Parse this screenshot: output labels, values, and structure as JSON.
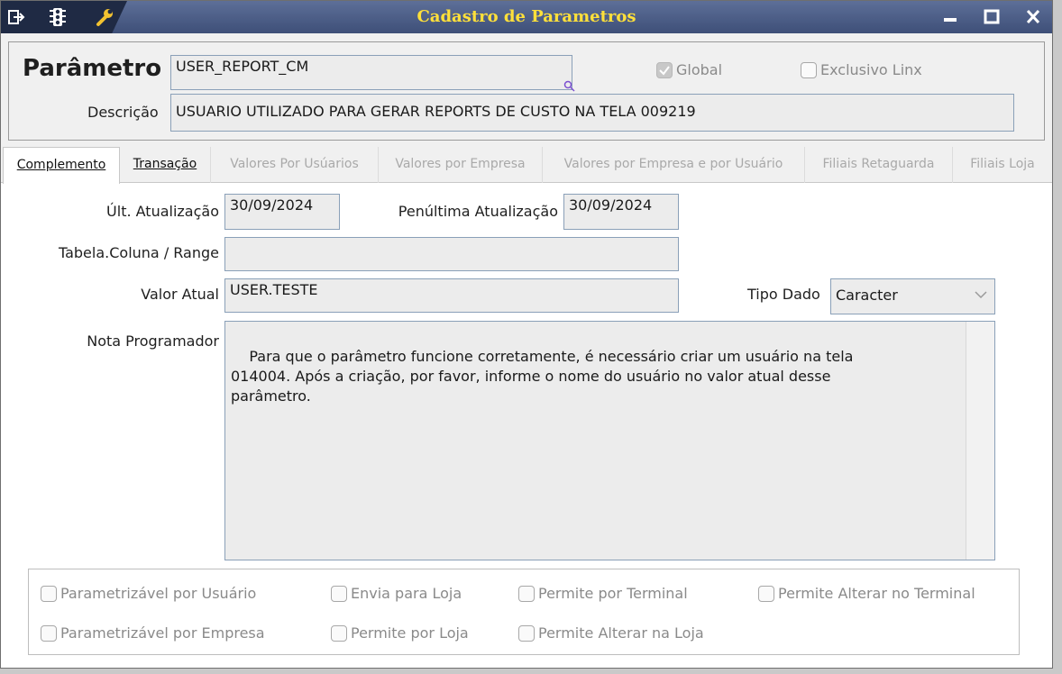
{
  "window": {
    "title": "Cadastro de Parametros",
    "title_color": "#ffe03a",
    "titlebar_color": "#4a5b84",
    "icons": [
      "exit-icon",
      "traffic-light-icon",
      "wrench-icon"
    ],
    "controls": [
      "minimize-icon",
      "maximize-icon",
      "close-icon"
    ]
  },
  "header": {
    "parametro_label": "Parâmetro",
    "parametro_value": "USER_REPORT_CM",
    "descricao_label": "Descrição",
    "descricao_value": "USUARIO UTILIZADO PARA GERAR REPORTS DE CUSTO NA TELA 009219",
    "global_label": "Global",
    "global_checked": true,
    "exclusivo_label": "Exclusivo Linx",
    "exclusivo_checked": false
  },
  "tabs": [
    {
      "label": "Complemento",
      "state": "active"
    },
    {
      "label": "Transação",
      "state": "enabled"
    },
    {
      "label": "Valores Por Usúarios",
      "state": "disabled"
    },
    {
      "label": "Valores por Empresa",
      "state": "disabled"
    },
    {
      "label": "Valores por Empresa e por Usuário",
      "state": "disabled"
    },
    {
      "label": "Filiais Retaguarda",
      "state": "disabled"
    },
    {
      "label": "Filiais Loja",
      "state": "disabled"
    }
  ],
  "complemento": {
    "ult_atualizacao_label": "Últ. Atualização",
    "ult_atualizacao_value": "30/09/2024",
    "penultima_label": "Penúltima Atualização",
    "penultima_value": "30/09/2024",
    "tabela_label": "Tabela.Coluna / Range",
    "tabela_value": "",
    "valor_atual_label": "Valor Atual",
    "valor_atual_value": "USER.TESTE",
    "tipo_dado_label": "Tipo Dado",
    "tipo_dado_value": "Caracter",
    "nota_label": "Nota Programador",
    "nota_value": "Para que o parâmetro funcione corretamente, é necessário criar um usuário na tela\n014004. Após a criação, por favor, informe o nome do usuário no valor atual desse\nparâmetro."
  },
  "flags": {
    "parametrizavel_usuario": "Parametrizável por Usuário",
    "envia_loja": "Envia para Loja",
    "permite_terminal": "Permite por Terminal",
    "permite_alterar_terminal": "Permite Alterar no Terminal",
    "parametrizavel_empresa": "Parametrizável por Empresa",
    "permite_loja": "Permite por Loja",
    "permite_alterar_loja": "Permite Alterar na Loja"
  }
}
